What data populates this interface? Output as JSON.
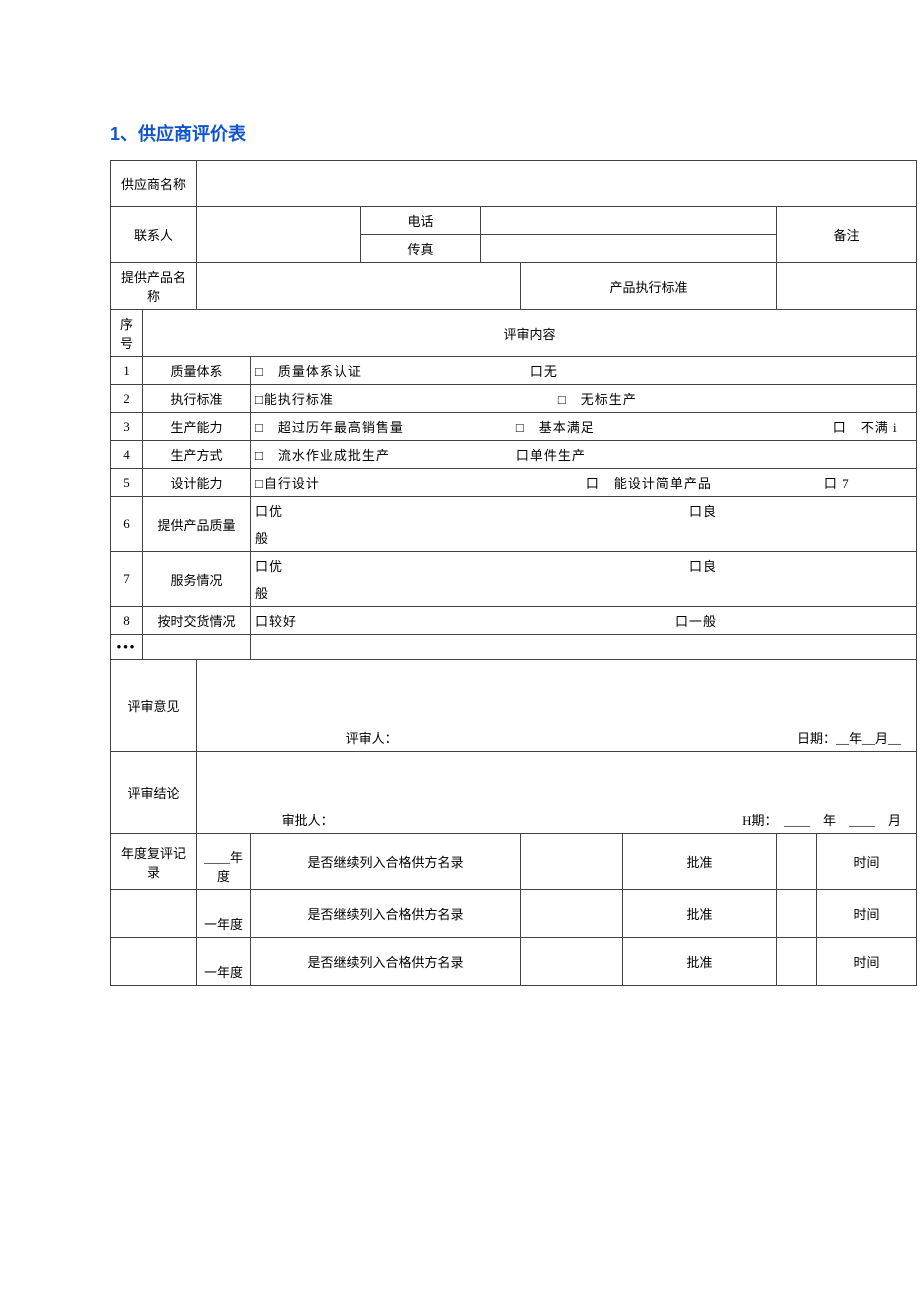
{
  "title_prefix": "1",
  "title_sep": "、",
  "title_text": "供应商评价表",
  "header": {
    "supplier_name_label": "供应商名称",
    "contact_label": "联系人",
    "phone_label": "电话",
    "fax_label": "传真",
    "remark_label": "备注",
    "product_name_label": "提供产品名称",
    "product_standard_label": "产品执行标准"
  },
  "seq_label": "序号",
  "content_label": "评审内容",
  "rows": [
    {
      "no": "1",
      "item": "质量体系",
      "opts": "□　质量体系认证　　　　　　　　　　　　口无"
    },
    {
      "no": "2",
      "item": "执行标准",
      "opts": "□能执行标准　　　　　　　　　　　　　　　　□　无标生产"
    },
    {
      "no": "3",
      "item": "生产能力",
      "opts": "□　超过历年最高销售量　　　　　　　　□　基本满足　　　　　　　　　　　　　　　　　口　不满 i"
    },
    {
      "no": "4",
      "item": "生产方式",
      "opts": "□　流水作业成批生产　　　　　　　　　口单件生产"
    },
    {
      "no": "5",
      "item": "设计能力",
      "opts": "□自行设计　　　　　　　　　　　　　　　　　　　口　能设计简单产品　　　　　　　　口 7"
    },
    {
      "no": "6",
      "item": "提供产品质量",
      "opts": "口优　　　　　　　　　　　　　　　　　　　　　　　　　　　　　口良",
      "extra": "般"
    },
    {
      "no": "7",
      "item": "服务情况",
      "opts": "口优　　　　　　　　　　　　　　　　　　　　　　　　　　　　　口良",
      "extra": "般"
    },
    {
      "no": "8",
      "item": "按时交货情况",
      "opts": "口较好　　　　　　　　　　　　　　　　　　　　　　　　　　　口一般"
    }
  ],
  "ellipsis": "•••",
  "review": {
    "opinion_label": "评审意见",
    "reviewer_label": "评审人：",
    "date_label": "日期：__年__月__",
    "conclusion_label": "评审结论",
    "approver_label": "审批人：",
    "h_date_label": "H期：",
    "year_char": "年",
    "month_char": "月"
  },
  "annual": {
    "label": "年度复评记录",
    "year1": "____年度",
    "year2": "一年度",
    "year3": "一年度",
    "continue_label": "是否继续列入合格供方名录",
    "approve_label": "批准",
    "time_label": "时间"
  }
}
